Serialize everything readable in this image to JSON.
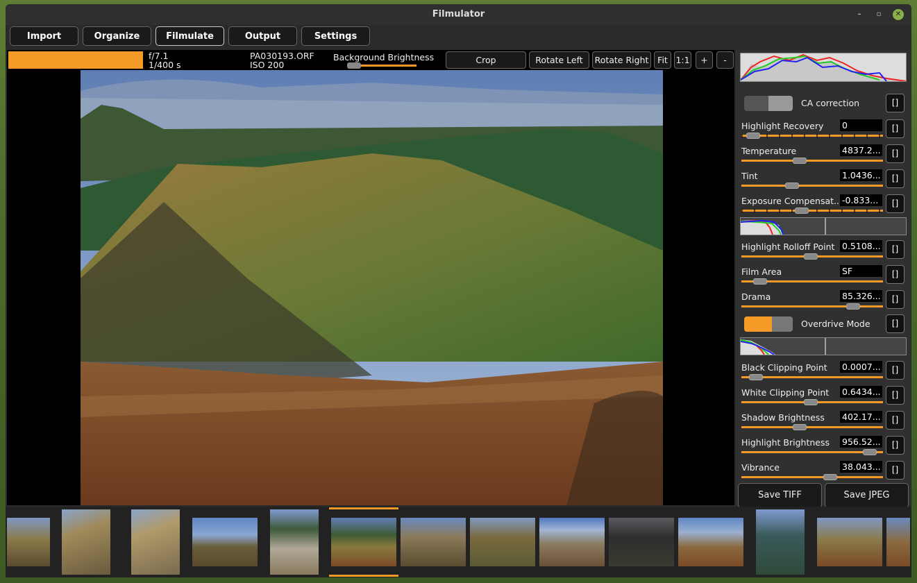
{
  "window": {
    "title": "Filmulator"
  },
  "nav": {
    "tabs": [
      "Import",
      "Organize",
      "Filmulate",
      "Output",
      "Settings"
    ],
    "active": "Filmulate"
  },
  "toolbar": {
    "aperture": "f/7.1",
    "shutter": "1/400 s",
    "filename": "PA030193.ORF",
    "iso": "ISO 200",
    "bg_label": "Background Brightness",
    "crop": "Crop",
    "rotate_left": "Rotate Left",
    "rotate_right": "Rotate Right",
    "fit": "Fit",
    "one_to_one": "1:1",
    "zoom_in": "+",
    "zoom_out": "-",
    "background_brightness_level": 0.05
  },
  "panel": {
    "reset_label": "[]",
    "ca_correction": {
      "label": "CA correction",
      "on": false
    },
    "highlight_recovery": {
      "label": "Highlight Recovery",
      "value": "0",
      "level": 0.04
    },
    "temperature": {
      "label": "Temperature",
      "value": "4837.2...",
      "level": 0.4
    },
    "tint": {
      "label": "Tint",
      "value": "1.0436...",
      "level": 0.34
    },
    "exposure": {
      "label": "Exposure Compensat...",
      "value": "-0.833...",
      "level": 0.42
    },
    "highlight_rolloff": {
      "label": "Highlight Rolloff Point",
      "value": "0.5108...",
      "level": 0.49
    },
    "film_area": {
      "label": "Film Area",
      "value": "SF",
      "level": 0.09
    },
    "drama": {
      "label": "Drama",
      "value": "85.326...",
      "level": 0.82
    },
    "overdrive": {
      "label": "Overdrive Mode",
      "on": true
    },
    "black_clip": {
      "label": "Black Clipping Point",
      "value": "0.0007...",
      "level": 0.06
    },
    "white_clip": {
      "label": "White Clipping Point",
      "value": "0.6434...",
      "level": 0.49
    },
    "shadow_brightness": {
      "label": "Shadow Brightness",
      "value": "402.17...",
      "level": 0.4
    },
    "highlight_brightness": {
      "label": "Highlight Brightness",
      "value": "956.52...",
      "level": 0.95
    },
    "vibrance": {
      "label": "Vibrance",
      "value": "38.043...",
      "level": 0.64
    },
    "save_tiff": "Save TIFF",
    "save_jpeg": "Save JPEG"
  },
  "colors": {
    "accent": "#f59a26",
    "panel": "#303030",
    "window": "#2a2a2a"
  },
  "icons": {
    "minimize": "minimize-icon",
    "maximize": "maximize-icon",
    "close": "close-icon"
  }
}
